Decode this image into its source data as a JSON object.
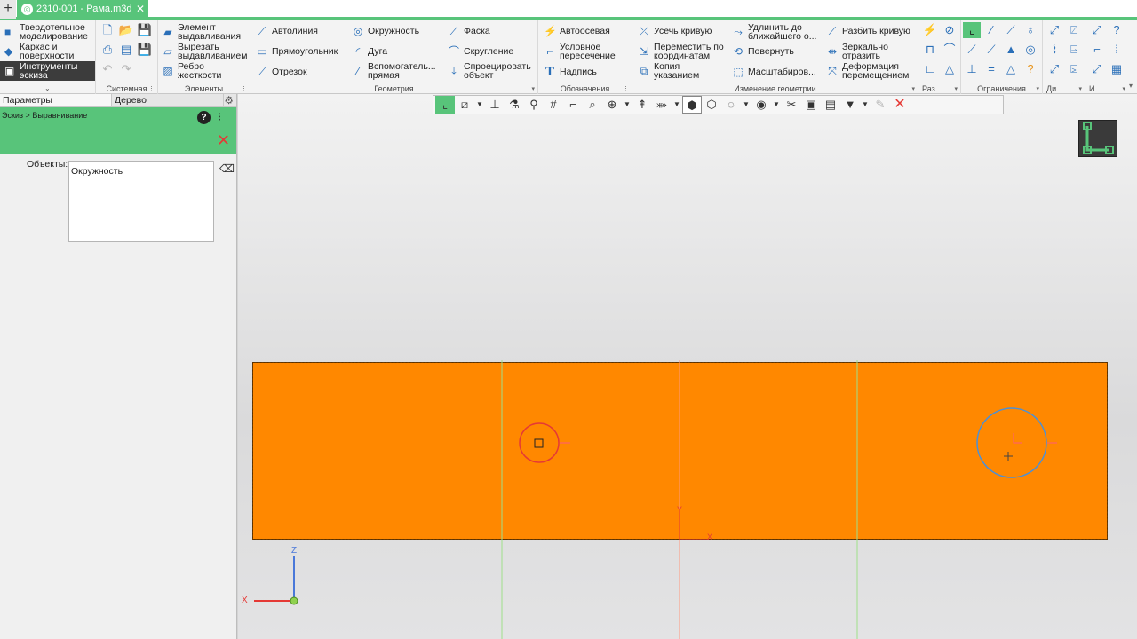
{
  "tab": {
    "title": "2310-001 - Рама.m3d",
    "new_tab": "+",
    "close": "✕"
  },
  "modes": [
    {
      "label": "Твердотельное моделирование",
      "icon": "solid-icon"
    },
    {
      "label": "Каркас и поверхности",
      "icon": "surface-icon"
    },
    {
      "label": "Инструменты эскиза",
      "icon": "sketch-tools-icon"
    }
  ],
  "groups": {
    "system": "Системная",
    "elements": "Элементы",
    "geometry": "Геометрия",
    "designations": "Обозначения",
    "edit_geometry": "Изменение геометрии",
    "dimensions_short": "Раз...",
    "constraints": "Ограничения",
    "di_short": "Ди...",
    "i_short": "И..."
  },
  "elements": [
    "Элемент выдавливания",
    "Вырезать выдавливанием",
    "Ребро жесткости"
  ],
  "geometry": {
    "col1": [
      "Автолиния",
      "Прямоугольник",
      "Отрезок"
    ],
    "col2": [
      "Окружность",
      "Дуга",
      "Вспомогатель... прямая"
    ],
    "col3": [
      "Фаска",
      "Скругление",
      "Спроецировать объект"
    ]
  },
  "designations": [
    "Автоосевая",
    "Условное пересечение",
    "Надпись"
  ],
  "edit_geometry": {
    "col1": [
      "Усечь кривую",
      "Переместить по координатам",
      "Копия указанием"
    ],
    "col2": [
      "Удлинить до ближайшего о...",
      "Повернуть",
      "Масштабиров..."
    ],
    "col3": [
      "Разбить кривую",
      "Зеркально отразить",
      "Деформация перемещением"
    ]
  },
  "panel": {
    "tab_params": "Параметры",
    "tab_tree": "Дерево",
    "breadcrumb": "Эскиз > Выравнивание",
    "objects_label": "Объекты:",
    "objects_value": "Окружность",
    "help": "?"
  },
  "axes": {
    "x": "X",
    "y": "Y",
    "z": "Z"
  },
  "colors": {
    "accent": "#58c47a",
    "part": "#ff8800",
    "selected": "#e53935",
    "hover": "#4a90d9"
  }
}
